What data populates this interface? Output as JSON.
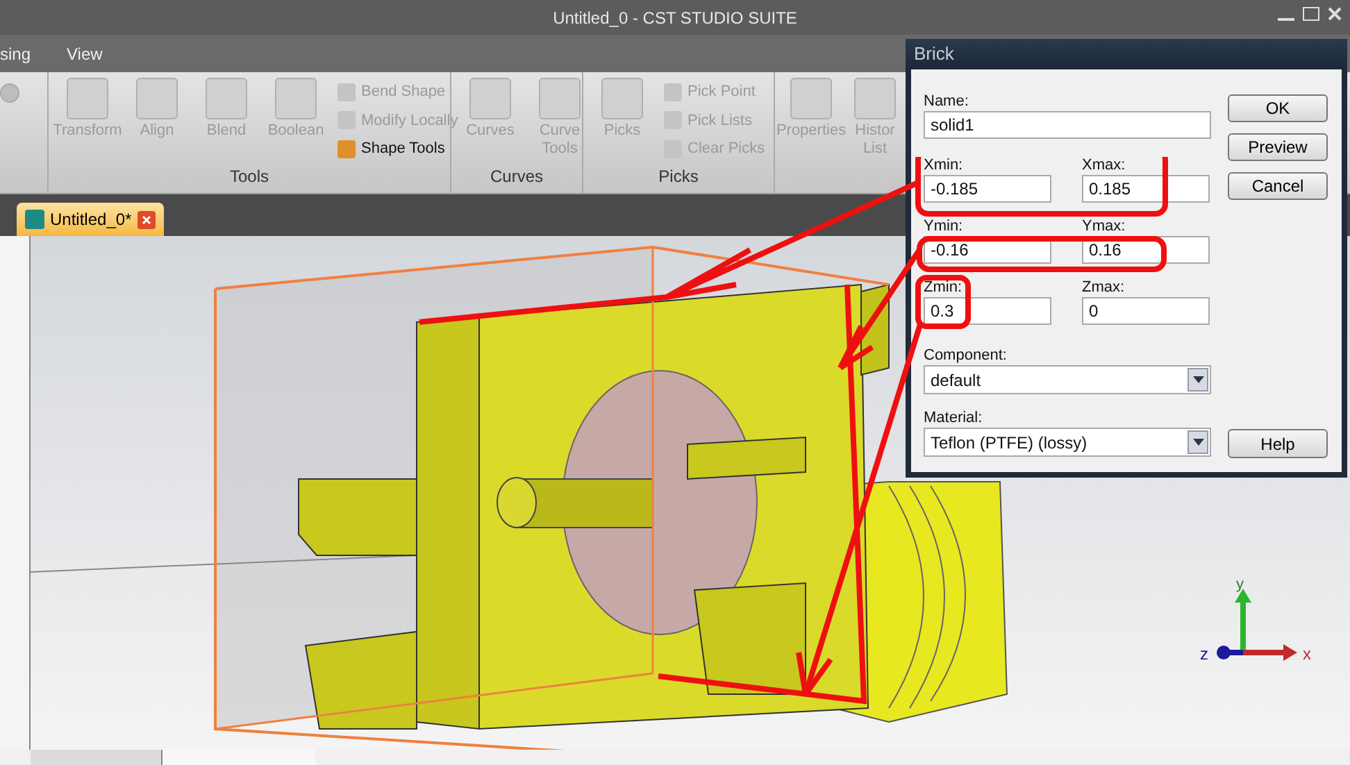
{
  "window": {
    "title": "Untitled_0 - CST STUDIO SUITE"
  },
  "menu": [
    {
      "label": "sing",
      "selected": false
    },
    {
      "label": "View",
      "selected": false
    }
  ],
  "ribbon": {
    "groups": [
      {
        "label": "Tools",
        "large": [
          {
            "label": "Transform",
            "disabled": true
          },
          {
            "label": "Align",
            "disabled": true
          },
          {
            "label": "Blend",
            "disabled": true
          },
          {
            "label": "Boolean",
            "disabled": true
          }
        ],
        "small": [
          {
            "label": "Bend Shape",
            "disabled": true
          },
          {
            "label": "Modify Locally",
            "disabled": true
          },
          {
            "label": "Shape Tools",
            "disabled": false
          }
        ]
      },
      {
        "label": "Curves",
        "large": [
          {
            "label": "Curves",
            "disabled": true
          },
          {
            "label": "Curve Tools",
            "disabled": true
          }
        ]
      },
      {
        "label": "Picks",
        "large": [
          {
            "label": "Picks",
            "disabled": true
          }
        ],
        "small": [
          {
            "label": "Pick Point",
            "disabled": true
          },
          {
            "label": "Pick Lists",
            "disabled": true
          },
          {
            "label": "Clear Picks",
            "disabled": true
          }
        ]
      },
      {
        "large": [
          {
            "label": "Properties",
            "disabled": true
          },
          {
            "label": "Histor List",
            "disabled": true
          }
        ]
      }
    ]
  },
  "document_tab": {
    "label": "Untitled_0*",
    "selected": true
  },
  "dialog": {
    "title": "Brick",
    "name": {
      "label": "Name:",
      "value": "solid1"
    },
    "coords": [
      {
        "label": "Xmin:",
        "value": "-0.185"
      },
      {
        "label": "Xmax:",
        "value": "0.185"
      },
      {
        "label": "Ymin:",
        "value": "-0.16"
      },
      {
        "label": "Ymax:",
        "value": "0.16"
      },
      {
        "label": "Zmin:",
        "value": "0.3"
      },
      {
        "label": "Zmax:",
        "value": "0"
      }
    ],
    "component": {
      "label": "Component:",
      "value": "default"
    },
    "material": {
      "label": "Material:",
      "value": "Teflon (PTFE) (lossy)"
    },
    "buttons": [
      "OK",
      "Preview",
      "Cancel"
    ],
    "help_button": "Help"
  },
  "axes": {
    "x": "x",
    "y": "y",
    "z": "z"
  }
}
